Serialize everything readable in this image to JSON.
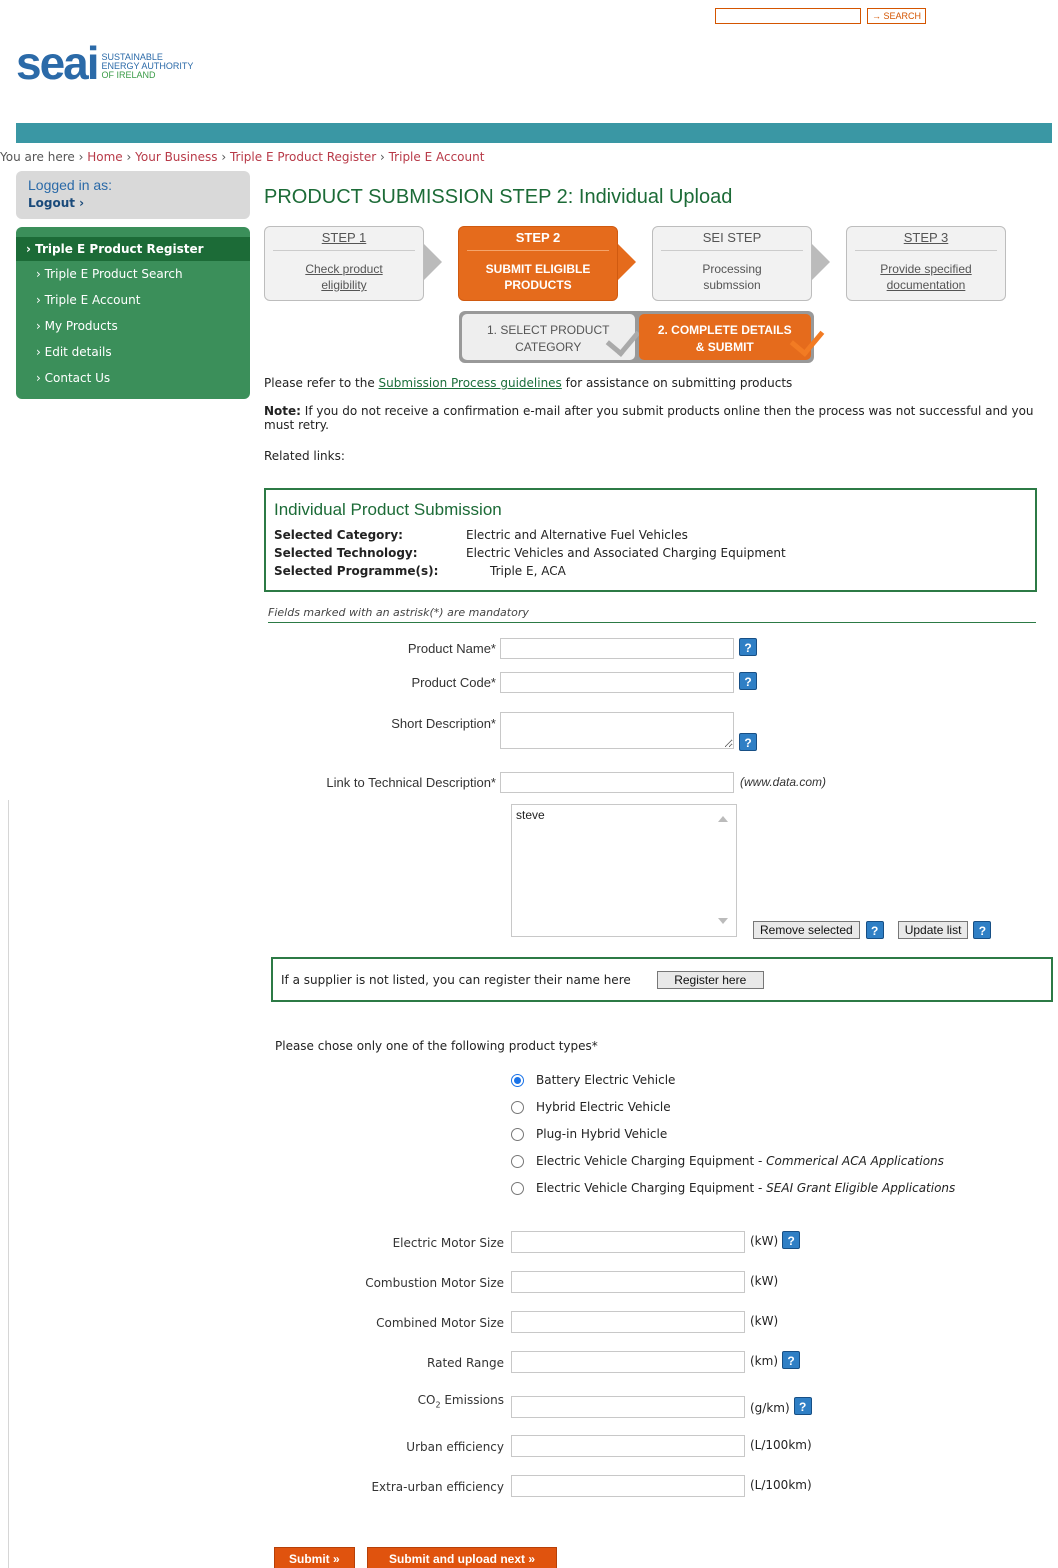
{
  "top_search": {
    "value": "",
    "button_label": "→ SEARCH"
  },
  "logo": {
    "word": "seai",
    "line1": "SUSTAINABLE",
    "line2": "ENERGY AUTHORITY",
    "line3": "OF IRELAND"
  },
  "breadcrumb": {
    "prefix": "You are here",
    "sep": "›",
    "items": [
      "Home",
      "Your Business",
      "Triple E Product Register",
      "Triple E Account"
    ]
  },
  "login": {
    "label": "Logged in as:",
    "logout": "Logout ›"
  },
  "sidebar": {
    "header": "› Triple E Product Register",
    "items": [
      "› Triple E Product Search",
      "› Triple E Account",
      "› My Products",
      "› Edit details",
      "› Contact Us"
    ]
  },
  "page_title": "PRODUCT SUBMISSION STEP 2: Individual Upload",
  "steps": [
    {
      "title": "STEP 1",
      "desc1": "Check product",
      "desc2": "eligibility"
    },
    {
      "title": "STEP 2",
      "desc1": "SUBMIT ELIGIBLE",
      "desc2": "PRODUCTS"
    },
    {
      "title": "SEI STEP",
      "desc1": "Processing",
      "desc2": "submssion"
    },
    {
      "title": "STEP 3",
      "desc1": "Provide specified",
      "desc2": "documentation"
    }
  ],
  "sub_steps": [
    {
      "line1": "1. SELECT PRODUCT",
      "line2": "CATEGORY"
    },
    {
      "line1": "2. COMPLETE DETAILS",
      "line2": "& SUBMIT"
    }
  ],
  "notes": {
    "refer_pre": "Please refer to the ",
    "refer_link": "Submission Process guidelines",
    "refer_post": " for assistance on submitting products",
    "note_label": "Note:",
    "note_text": " If you do not receive a confirmation e-mail after you submit products online then the process was not successful and you must retry.",
    "related": "Related links:"
  },
  "submission": {
    "title": "Individual Product Submission",
    "rows": [
      {
        "key": "Selected Category:",
        "value": "Electric and Alternative Fuel Vehicles"
      },
      {
        "key": "Selected Technology:",
        "value": "Electric Vehicles and Associated Charging Equipment"
      },
      {
        "key": "Selected Programme(s):",
        "value": "Triple E, ACA"
      }
    ]
  },
  "mandatory_note": "Fields marked with an astrisk(*) are mandatory",
  "fields": {
    "product_name": {
      "label": "Product Name*",
      "value": ""
    },
    "product_code": {
      "label": "Product Code*",
      "value": ""
    },
    "short_description": {
      "label": "Short Description*",
      "value": ""
    },
    "tech_link": {
      "label": "Link to Technical Description*",
      "value": "",
      "hint": "(www.data.com)"
    }
  },
  "supplier_list": {
    "items": [
      "steve"
    ],
    "remove_label": "Remove selected",
    "update_label": "Update list"
  },
  "register": {
    "text": "If a supplier is not listed, you can register their name here",
    "button": "Register here"
  },
  "product_types": {
    "prompt": "Please chose only one of the following product types*",
    "options": [
      {
        "label": "Battery Electric Vehicle",
        "suffix": "",
        "selected": true
      },
      {
        "label": "Hybrid Electric Vehicle",
        "suffix": "",
        "selected": false
      },
      {
        "label": "Plug-in Hybrid Vehicle",
        "suffix": "",
        "selected": false
      },
      {
        "label": "Electric Vehicle Charging Equipment - ",
        "suffix": "Commerical ACA Applications",
        "selected": false
      },
      {
        "label": "Electric Vehicle Charging Equipment - ",
        "suffix": "SEAI Grant Eligible Applications",
        "selected": false
      }
    ]
  },
  "specs": [
    {
      "label": "Electric Motor Size",
      "unit": "(kW)",
      "value": "",
      "help": true
    },
    {
      "label": "Combustion Motor Size",
      "unit": "(kW)",
      "value": "",
      "help": false
    },
    {
      "label": "Combined Motor Size",
      "unit": "(kW)",
      "value": "",
      "help": false
    },
    {
      "label": "Rated Range",
      "unit": "(km)",
      "value": "",
      "help": true
    },
    {
      "label_main": "CO",
      "label_sub": "2",
      "label_rest": " Emissions",
      "unit": "(g/km)",
      "value": "",
      "help": true
    },
    {
      "label": "Urban efficiency",
      "unit": "(L/100km)",
      "value": "",
      "help": false
    },
    {
      "label": "Extra-urban efficiency",
      "unit": "(L/100km)",
      "value": "",
      "help": false
    }
  ],
  "help_glyph": "?",
  "buttons": {
    "submit": "Submit »",
    "submit_next": "Submit and upload next »"
  }
}
